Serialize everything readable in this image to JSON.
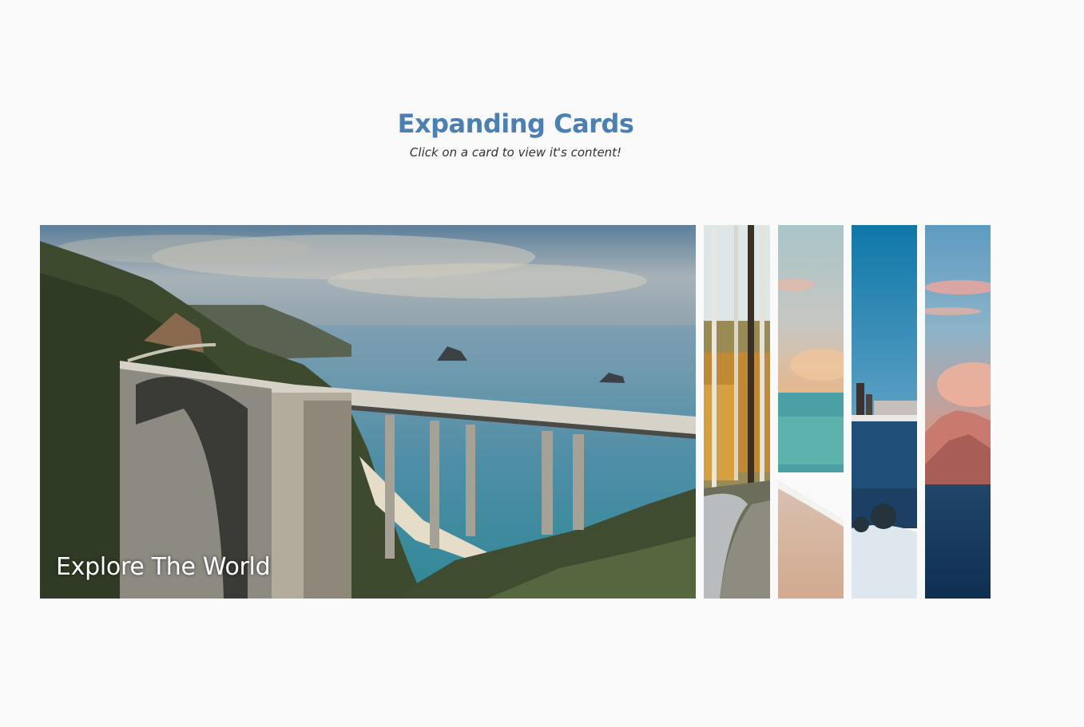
{
  "header": {
    "title": "Expanding Cards",
    "subtitle": "Click on a card to view it's content!"
  },
  "cards": [
    {
      "title": "Explore The World",
      "active": true
    },
    {
      "title": "",
      "active": false
    },
    {
      "title": "",
      "active": false
    },
    {
      "title": "",
      "active": false
    },
    {
      "title": "",
      "active": false
    }
  ],
  "colors": {
    "background": "#f9f9f9",
    "title": "#4a80b5",
    "subtitle": "#333333"
  }
}
